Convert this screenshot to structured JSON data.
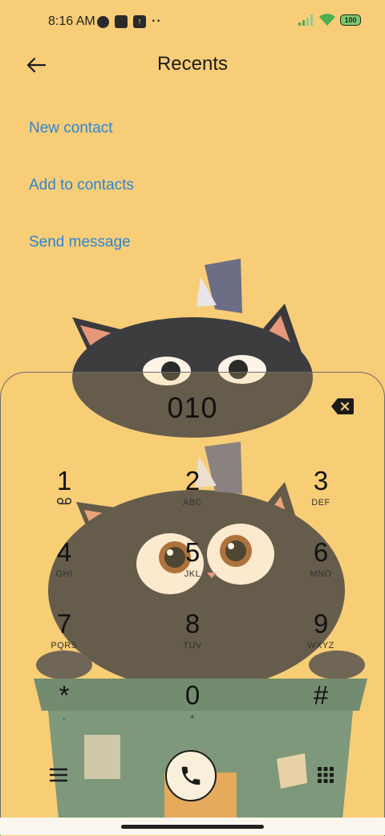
{
  "status_bar": {
    "time": "8:16 AM",
    "battery": "100",
    "icons": [
      "app-icon-circle",
      "app-icon-square",
      "upload-icon",
      "more-dots-icon",
      "signal-icon",
      "wifi-icon",
      "battery-icon"
    ],
    "dots": "··"
  },
  "header": {
    "title": "Recents",
    "back_icon": "back-arrow-icon"
  },
  "actions": {
    "new_contact": "New contact",
    "add_to_contacts": "Add to contacts",
    "send_message": "Send message"
  },
  "dialer": {
    "number": "010",
    "keys": [
      {
        "digit": "1",
        "letters": ""
      },
      {
        "digit": "2",
        "letters": "ABC"
      },
      {
        "digit": "3",
        "letters": "DEF"
      },
      {
        "digit": "4",
        "letters": "GHI"
      },
      {
        "digit": "5",
        "letters": "JKL"
      },
      {
        "digit": "6",
        "letters": "MNO"
      },
      {
        "digit": "7",
        "letters": "PQRS"
      },
      {
        "digit": "8",
        "letters": "TUV"
      },
      {
        "digit": "9",
        "letters": "WXYZ"
      },
      {
        "digit": "*",
        "letters": ","
      },
      {
        "digit": "0",
        "letters": "+"
      },
      {
        "digit": "#",
        "letters": ""
      }
    ],
    "icons": [
      "backspace-icon",
      "voicemail-icon",
      "menu-icon",
      "phone-icon",
      "dialpad-icon"
    ]
  },
  "colors": {
    "background": "#f8cd77",
    "accent_link": "#2b86d4",
    "text": "#1b1b1b"
  }
}
